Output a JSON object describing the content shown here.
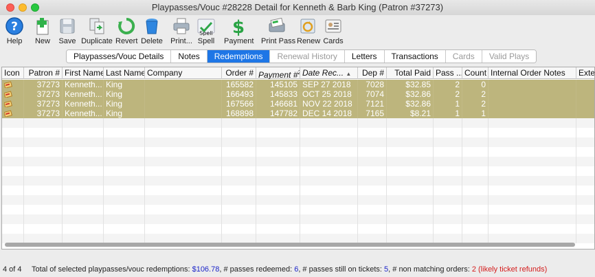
{
  "window": {
    "title": "Playpasses/Vouc #28228 Detail for Kenneth & Barb King (Patron #37273)"
  },
  "toolbar": [
    {
      "label": "Help",
      "icon": "help-icon"
    },
    {
      "label": "New",
      "icon": "new-icon"
    },
    {
      "label": "Save",
      "icon": "save-icon"
    },
    {
      "label": "Duplicate",
      "icon": "duplicate-icon"
    },
    {
      "label": "Revert",
      "icon": "revert-icon"
    },
    {
      "label": "Delete",
      "icon": "delete-icon"
    },
    {
      "label": "Print...",
      "icon": "print-icon"
    },
    {
      "label": "Spell",
      "icon": "spell-icon"
    },
    {
      "label": "Payment",
      "icon": "payment-icon"
    },
    {
      "label": "Print Pass",
      "icon": "print-pass-icon"
    },
    {
      "label": "Renew",
      "icon": "renew-icon"
    },
    {
      "label": "Cards",
      "icon": "cards-icon"
    }
  ],
  "spell_badge": "Spell",
  "tabs": [
    {
      "label": "Playpasses/Vouc Details",
      "state": "normal"
    },
    {
      "label": "Notes",
      "state": "normal"
    },
    {
      "label": "Redemptions",
      "state": "active"
    },
    {
      "label": "Renewal History",
      "state": "disabled"
    },
    {
      "label": "Letters",
      "state": "normal"
    },
    {
      "label": "Transactions",
      "state": "normal"
    },
    {
      "label": "Cards",
      "state": "disabled"
    },
    {
      "label": "Valid Plays",
      "state": "disabled"
    }
  ],
  "table": {
    "columns": [
      "Icon",
      "Patron #",
      "First Name",
      "Last Name",
      "Company",
      "Order #",
      "Payment #",
      "Date Rec...",
      "Dep #",
      "Total Paid",
      "Pass ...",
      "Count",
      "Internal Order Notes",
      "Exter"
    ],
    "payment_superscript": "2",
    "sort_indicator": "▲",
    "rows": [
      [
        "",
        "37273",
        "Kenneth...",
        "King",
        "",
        "165582",
        "145105",
        "SEP 27 2018",
        "7028",
        "$32.85",
        "2",
        "0",
        "",
        ""
      ],
      [
        "",
        "37273",
        "Kenneth...",
        "King",
        "",
        "166493",
        "145833",
        "OCT 25 2018",
        "7074",
        "$32.86",
        "2",
        "2",
        "",
        ""
      ],
      [
        "",
        "37273",
        "Kenneth...",
        "King",
        "",
        "167566",
        "146681",
        "NOV 22 2018",
        "7121",
        "$32.86",
        "1",
        "2",
        "",
        ""
      ],
      [
        "",
        "37273",
        "Kenneth...",
        "King",
        "",
        "168898",
        "147782",
        "DEC 14 2018",
        "7165",
        "$8.21",
        "1",
        "1",
        "",
        ""
      ]
    ]
  },
  "status": {
    "count": "4 of 4",
    "prefix": "Total of selected playpasses/vouc redemptions: ",
    "total": "$106.78",
    "redeemed_label": ", # passes redeemed: ",
    "redeemed": "6",
    "on_tickets_label": ", # passes still on tickets: ",
    "on_tickets": "5",
    "non_matching_label": ", # non matching orders: ",
    "non_matching": "2 (likely ticket refunds)"
  },
  "colors": {
    "selected_row": "#bdb57d",
    "active_tab": "#1e76e6",
    "status_blue": "#1b24c8",
    "status_red": "#d41b1b"
  }
}
